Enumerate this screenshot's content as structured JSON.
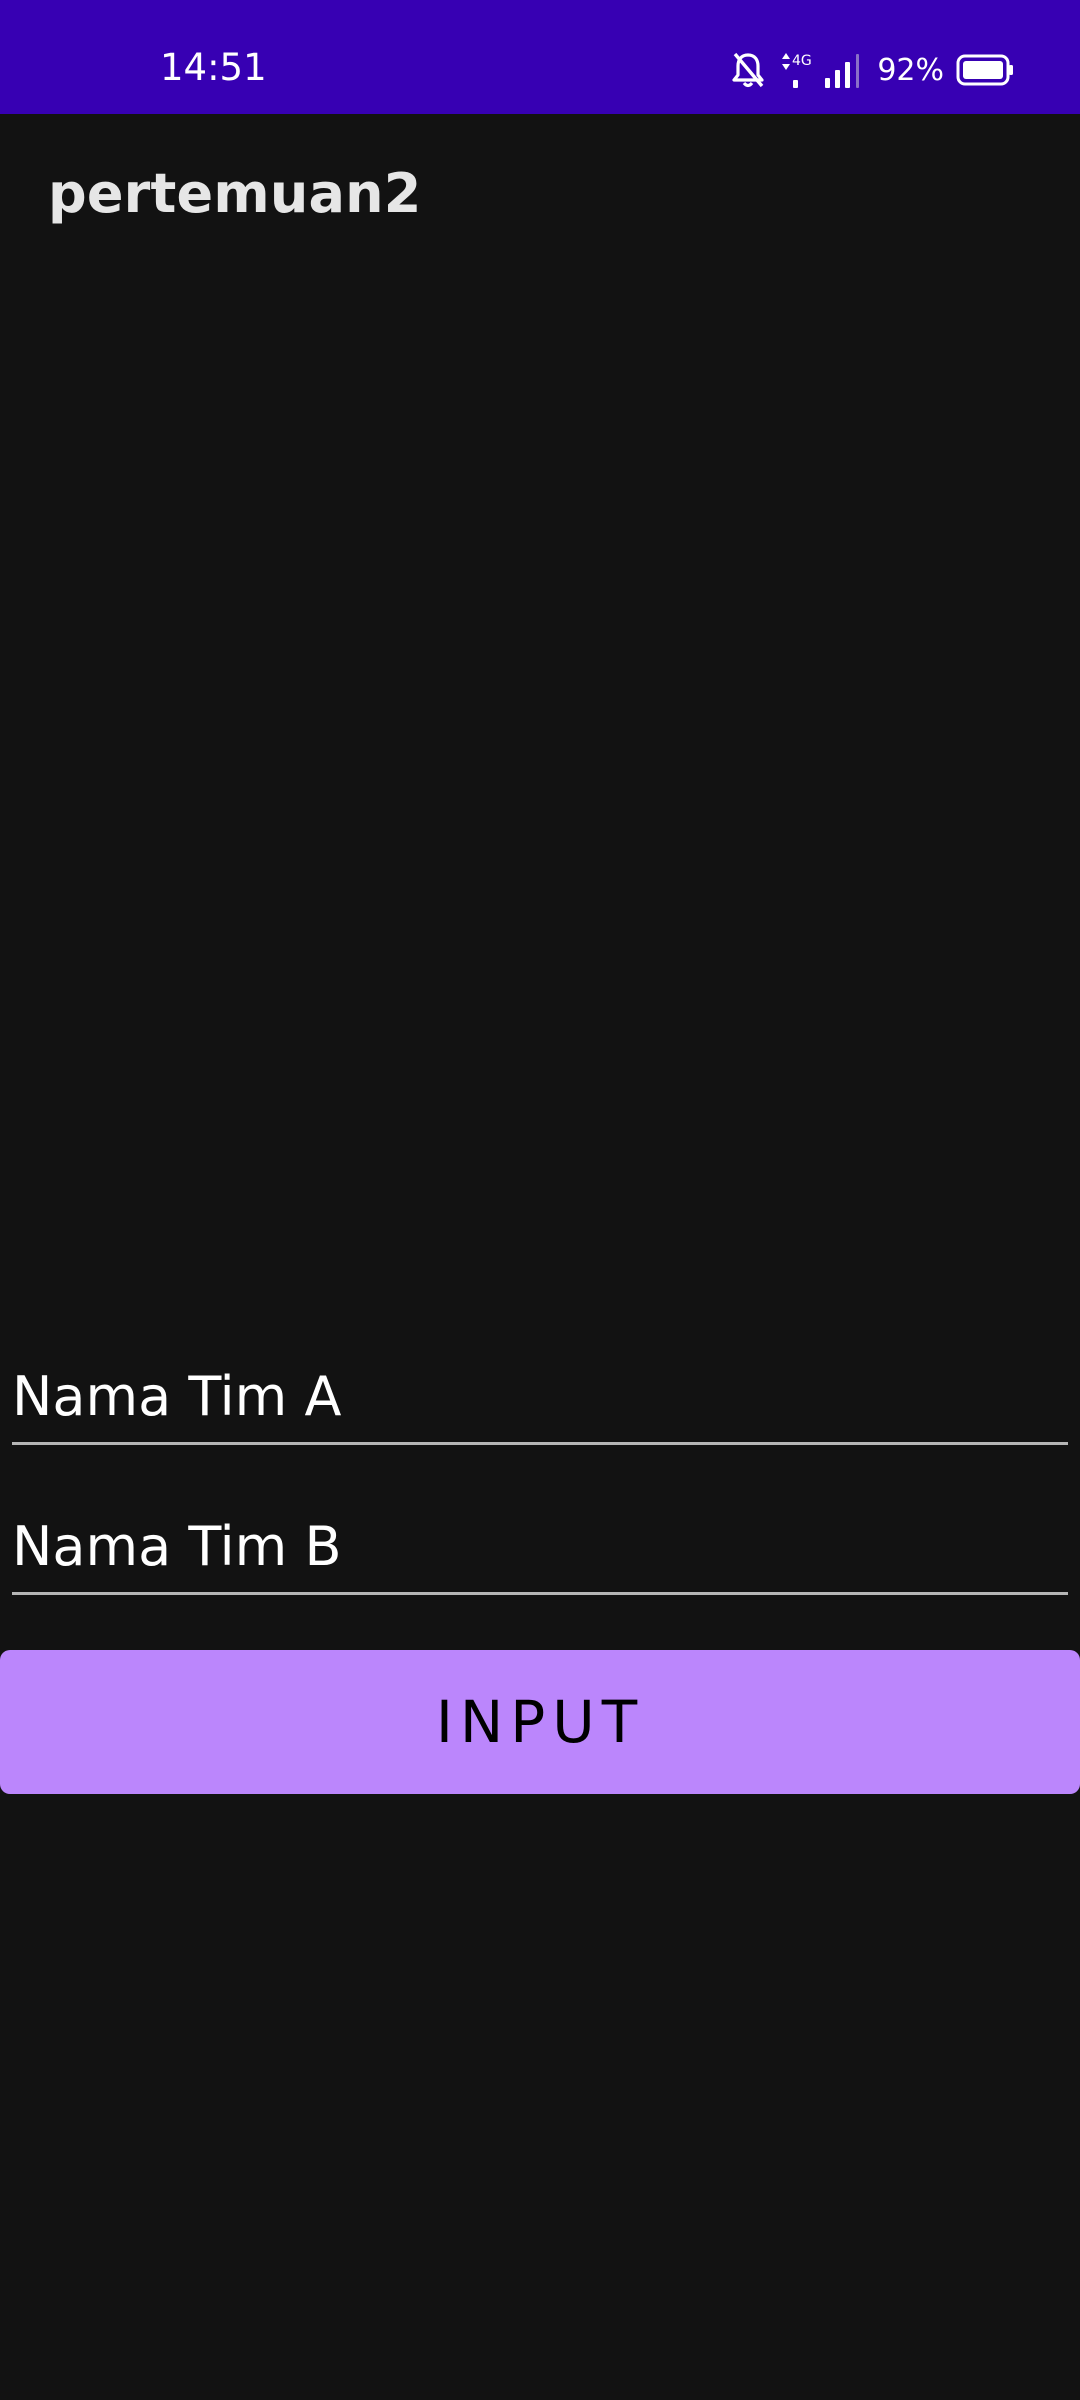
{
  "status_bar": {
    "time": "14:51",
    "network": "4G",
    "battery_percent": "92%",
    "icons": [
      "bell-off-icon",
      "mobile-data-icon",
      "signal-icon",
      "battery-icon"
    ],
    "background": "#3700B3"
  },
  "app_bar": {
    "title": "pertemuan2"
  },
  "form": {
    "team_a_placeholder": "Nama Tim A",
    "team_b_placeholder": "Nama Tim B",
    "submit_label": "INPUT"
  },
  "colors": {
    "background": "#121212",
    "accent": "#BB86FC",
    "status_bar": "#3700B3"
  }
}
